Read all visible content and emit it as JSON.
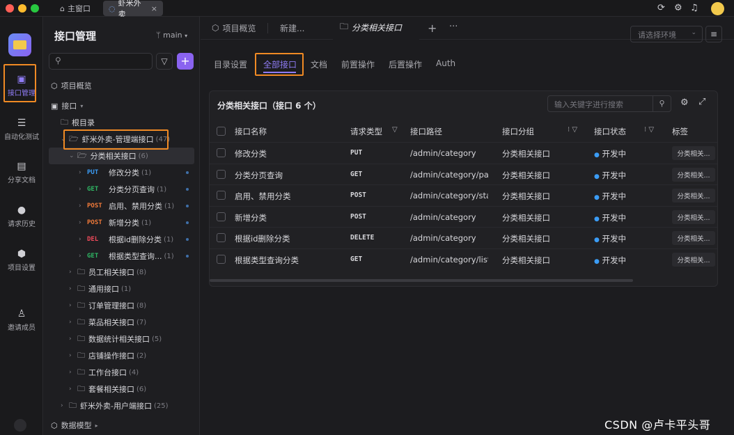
{
  "titlebar": {
    "home_tab": "主窗口",
    "project_tab": "虾米外卖",
    "close_glyph": "×"
  },
  "rail": {
    "items": [
      {
        "label": "接口管理",
        "icon": "api-icon"
      },
      {
        "label": "自动化测试",
        "icon": "stack-icon"
      },
      {
        "label": "分享文档",
        "icon": "book-icon"
      },
      {
        "label": "请求历史",
        "icon": "history-icon"
      },
      {
        "label": "项目设置",
        "icon": "settings-icon"
      },
      {
        "label": "邀请成员",
        "icon": "invite-user-icon"
      }
    ]
  },
  "sidebar": {
    "title": "接口管理",
    "branch": "main",
    "overview": "项目概览",
    "api_root": "接口",
    "root_dir": "根目录",
    "admin_folder": {
      "name": "虾米外卖-管理端接口",
      "count": "(47)"
    },
    "category_folder": {
      "name": "分类相关接口",
      "count": "(6)"
    },
    "apis": [
      {
        "method": "PUT",
        "name": "修改分类",
        "count": "(1)"
      },
      {
        "method": "GET",
        "name": "分类分页查询",
        "count": "(1)"
      },
      {
        "method": "POST",
        "name": "启用、禁用分类",
        "count": "(1)"
      },
      {
        "method": "POST",
        "name": "新增分类",
        "count": "(1)"
      },
      {
        "method": "DEL",
        "name": "根据id删除分类",
        "count": "(1)"
      },
      {
        "method": "GET",
        "name": "根据类型查询...",
        "count": "(1)"
      }
    ],
    "folders": [
      {
        "name": "员工相关接口",
        "count": "(8)"
      },
      {
        "name": "通用接口",
        "count": "(1)"
      },
      {
        "name": "订单管理接口",
        "count": "(8)"
      },
      {
        "name": "菜品相关接口",
        "count": "(7)"
      },
      {
        "name": "数据统计相关接口",
        "count": "(5)"
      },
      {
        "name": "店铺操作接口",
        "count": "(2)"
      },
      {
        "name": "工作台接口",
        "count": "(4)"
      },
      {
        "name": "套餐相关接口",
        "count": "(6)"
      }
    ],
    "user_folder": {
      "name": "虾米外卖-用户端接口",
      "count": "(25)"
    },
    "data_model": "数据模型"
  },
  "main": {
    "tabs": [
      {
        "label": "项目概览"
      },
      {
        "label": "新建..."
      },
      {
        "label": "分类相关接口"
      }
    ],
    "env_placeholder": "请选择环境",
    "subtabs": [
      "目录设置",
      "全部接口",
      "文档",
      "前置操作",
      "后置操作",
      "Auth"
    ],
    "panel_title": "分类相关接口（接口 6 个）",
    "search_placeholder": "输入关键字进行搜索",
    "columns": [
      "接口名称",
      "请求类型",
      "接口路径",
      "接口分组",
      "接口状态",
      "标签"
    ],
    "rows": [
      {
        "name": "修改分类",
        "method": "PUT",
        "path": "/admin/category",
        "group": "分类相关接口",
        "status": "开发中",
        "tag": "分类相关..."
      },
      {
        "name": "分类分页查询",
        "method": "GET",
        "path": "/admin/category/page",
        "group": "分类相关接口",
        "status": "开发中",
        "tag": "分类相关..."
      },
      {
        "name": "启用、禁用分类",
        "method": "POST",
        "path": "/admin/category/status",
        "group": "分类相关接口",
        "status": "开发中",
        "tag": "分类相关..."
      },
      {
        "name": "新增分类",
        "method": "POST",
        "path": "/admin/category",
        "group": "分类相关接口",
        "status": "开发中",
        "tag": "分类相关..."
      },
      {
        "name": "根据id删除分类",
        "method": "DELETE",
        "path": "/admin/category",
        "group": "分类相关接口",
        "status": "开发中",
        "tag": "分类相关..."
      },
      {
        "name": "根据类型查询分类",
        "method": "GET",
        "path": "/admin/category/list",
        "group": "分类相关接口",
        "status": "开发中",
        "tag": "分类相关..."
      }
    ]
  },
  "watermark": "CSDN @卢卡平头哥",
  "colors": {
    "accent": "#8a63f0",
    "highlight": "#f08a24",
    "put": "#3b9cf5",
    "get": "#2fb764",
    "post": "#f07a3a",
    "delete": "#ef4a5b"
  }
}
